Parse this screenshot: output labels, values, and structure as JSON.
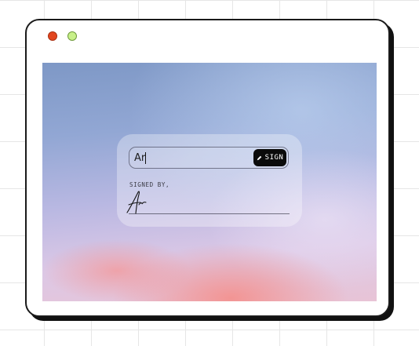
{
  "window": {
    "controls": [
      "close",
      "zoom"
    ]
  },
  "form": {
    "input_value": "Ar",
    "sign_button_label": "SIGN",
    "sign_button_icon": "pen-icon",
    "signed_by_label": "SIGNED BY,",
    "signature_text": "Ar"
  },
  "colors": {
    "close": "#e2461f",
    "zoom": "#c8f08a",
    "button": "#0b0b0b"
  }
}
